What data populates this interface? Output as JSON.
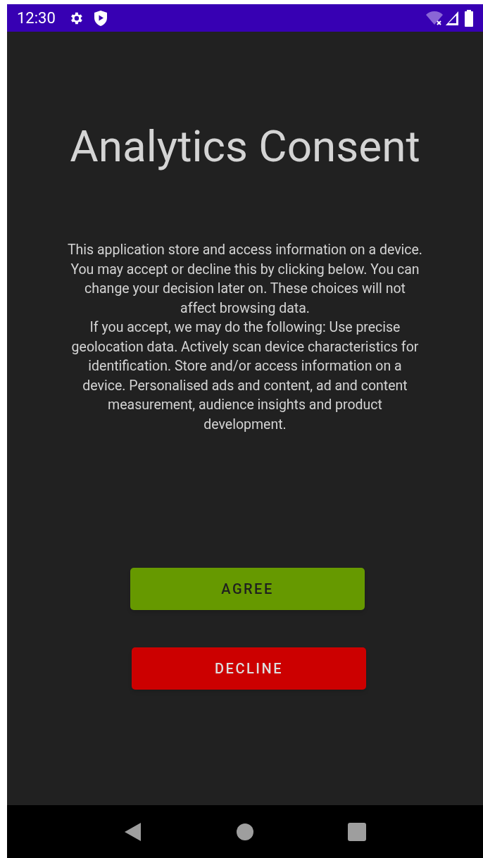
{
  "status_bar": {
    "time": "12:30"
  },
  "title": "Analytics Consent",
  "paragraphs": [
    "This application store and access information on a device. You may accept or decline this by clicking below. You can change your decision later on. These choices will not affect browsing data.",
    "If you accept, we may do the following: Use precise geolocation data. Actively scan device characteristics for identification. Store and/or access information on a device. Personalised ads and content, ad and content measurement, audience insights and product development."
  ],
  "buttons": [
    {
      "label": "AGREE",
      "kind": "agree"
    },
    {
      "label": "DECLINE",
      "kind": "decline"
    }
  ]
}
